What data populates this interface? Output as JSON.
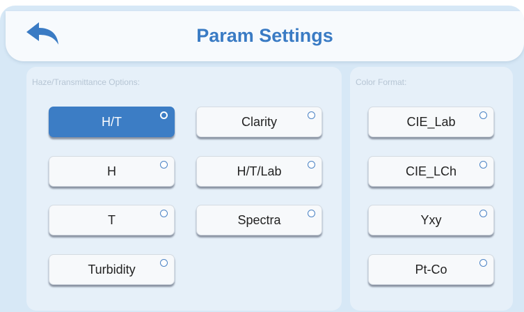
{
  "header": {
    "title": "Param Settings",
    "back_icon": "back-arrow-icon"
  },
  "haze_panel": {
    "label": "Haze/Transmittance Options:",
    "options": [
      {
        "label": "H/T",
        "selected": true
      },
      {
        "label": "Clarity",
        "selected": false
      },
      {
        "label": "H",
        "selected": false
      },
      {
        "label": "H/T/Lab",
        "selected": false
      },
      {
        "label": "T",
        "selected": false
      },
      {
        "label": "Spectra",
        "selected": false
      },
      {
        "label": "Turbidity",
        "selected": false
      }
    ]
  },
  "color_panel": {
    "label": "Color Format:",
    "options": [
      {
        "label": "CIE_Lab",
        "selected": false
      },
      {
        "label": "CIE_LCh",
        "selected": false
      },
      {
        "label": "Yxy",
        "selected": false
      },
      {
        "label": "Pt-Co",
        "selected": false
      }
    ]
  },
  "colors": {
    "accent": "#3c7dc5",
    "title": "#3a7bc4",
    "background": "#d7e8f6",
    "panel": "#e6f0f9"
  }
}
